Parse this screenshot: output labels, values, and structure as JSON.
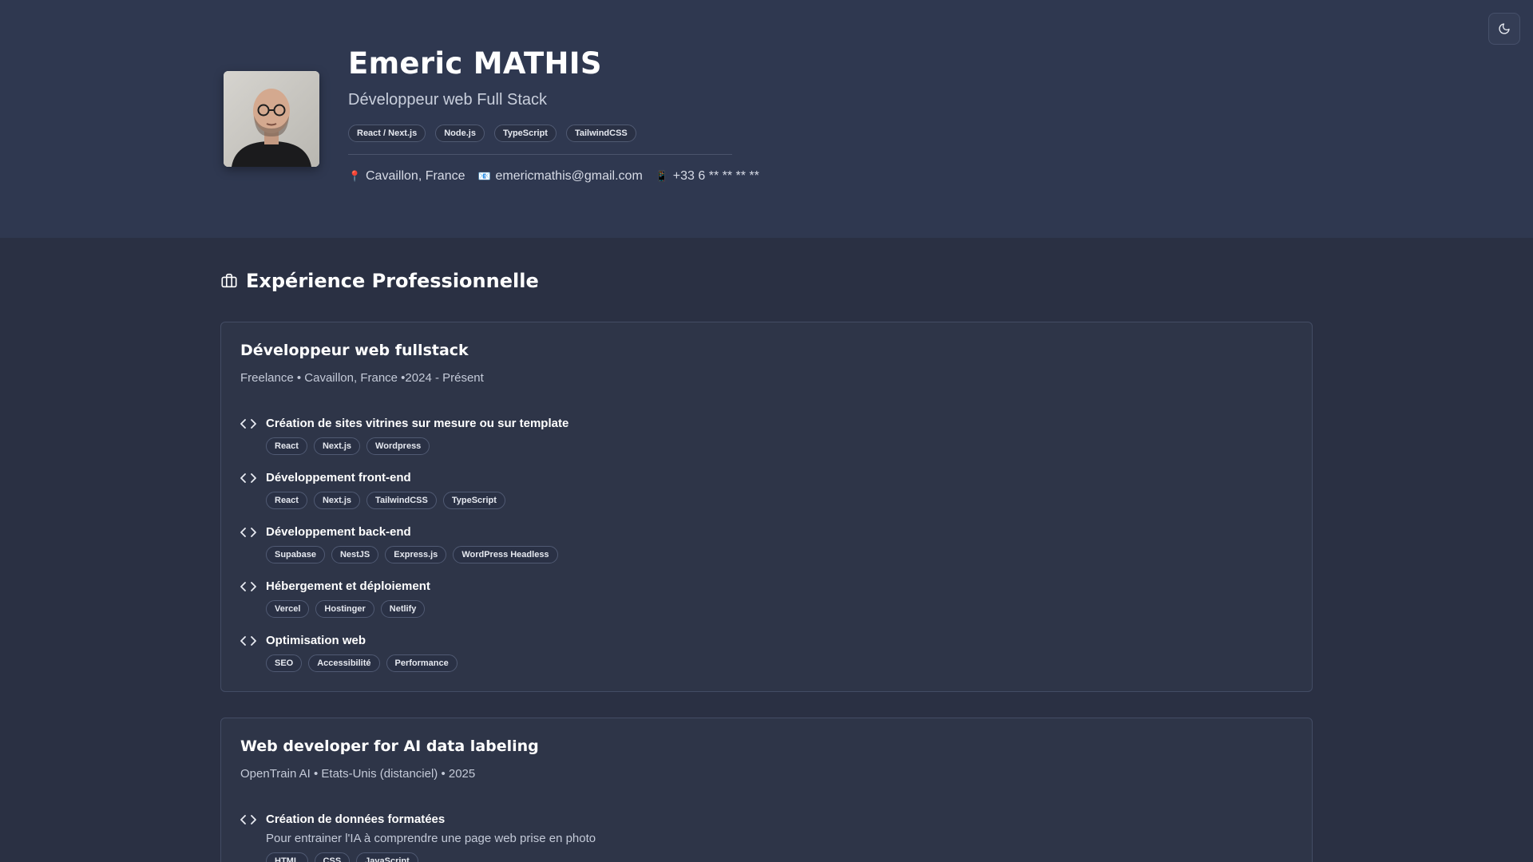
{
  "profile": {
    "name": "Emeric MATHIS",
    "role": "Développeur web Full Stack",
    "tags": [
      "React / Next.js",
      "Node.js",
      "TypeScript",
      "TailwindCSS"
    ],
    "location": "Cavaillon, France",
    "email": "emericmathis@gmail.com",
    "phone": "+33 6 ** ** ** **"
  },
  "theme_toggle": {
    "icon": "moon-icon"
  },
  "experience": {
    "title": "Expérience Professionnelle",
    "jobs": [
      {
        "title": "Développeur web fullstack",
        "meta": "Freelance • Cavaillon, France •2024 - Présent",
        "tasks": [
          {
            "title": "Création de sites vitrines sur mesure ou sur template",
            "tags": [
              "React",
              "Next.js",
              "Wordpress"
            ]
          },
          {
            "title": "Développement front-end",
            "tags": [
              "React",
              "Next.js",
              "TailwindCSS",
              "TypeScript"
            ]
          },
          {
            "title": "Développement back-end",
            "tags": [
              "Supabase",
              "NestJS",
              "Express.js",
              "WordPress Headless"
            ]
          },
          {
            "title": "Hébergement et déploiement",
            "tags": [
              "Vercel",
              "Hostinger",
              "Netlify"
            ]
          },
          {
            "title": "Optimisation web",
            "tags": [
              "SEO",
              "Accessibilité",
              "Performance"
            ]
          }
        ]
      },
      {
        "title": "Web developer for AI data labeling",
        "meta": "OpenTrain AI • Etats-Unis (distanciel) • 2025",
        "tasks": [
          {
            "title": "Création de données formatées",
            "desc": "Pour entrainer l'IA à comprendre une page web prise en photo",
            "tags": [
              "HTML",
              "CSS",
              "JavaScript"
            ]
          }
        ]
      }
    ]
  },
  "colors": {
    "background": "#2a3043",
    "header": "#2f3850",
    "card": "#2e3548",
    "accent": "#ffffff"
  }
}
